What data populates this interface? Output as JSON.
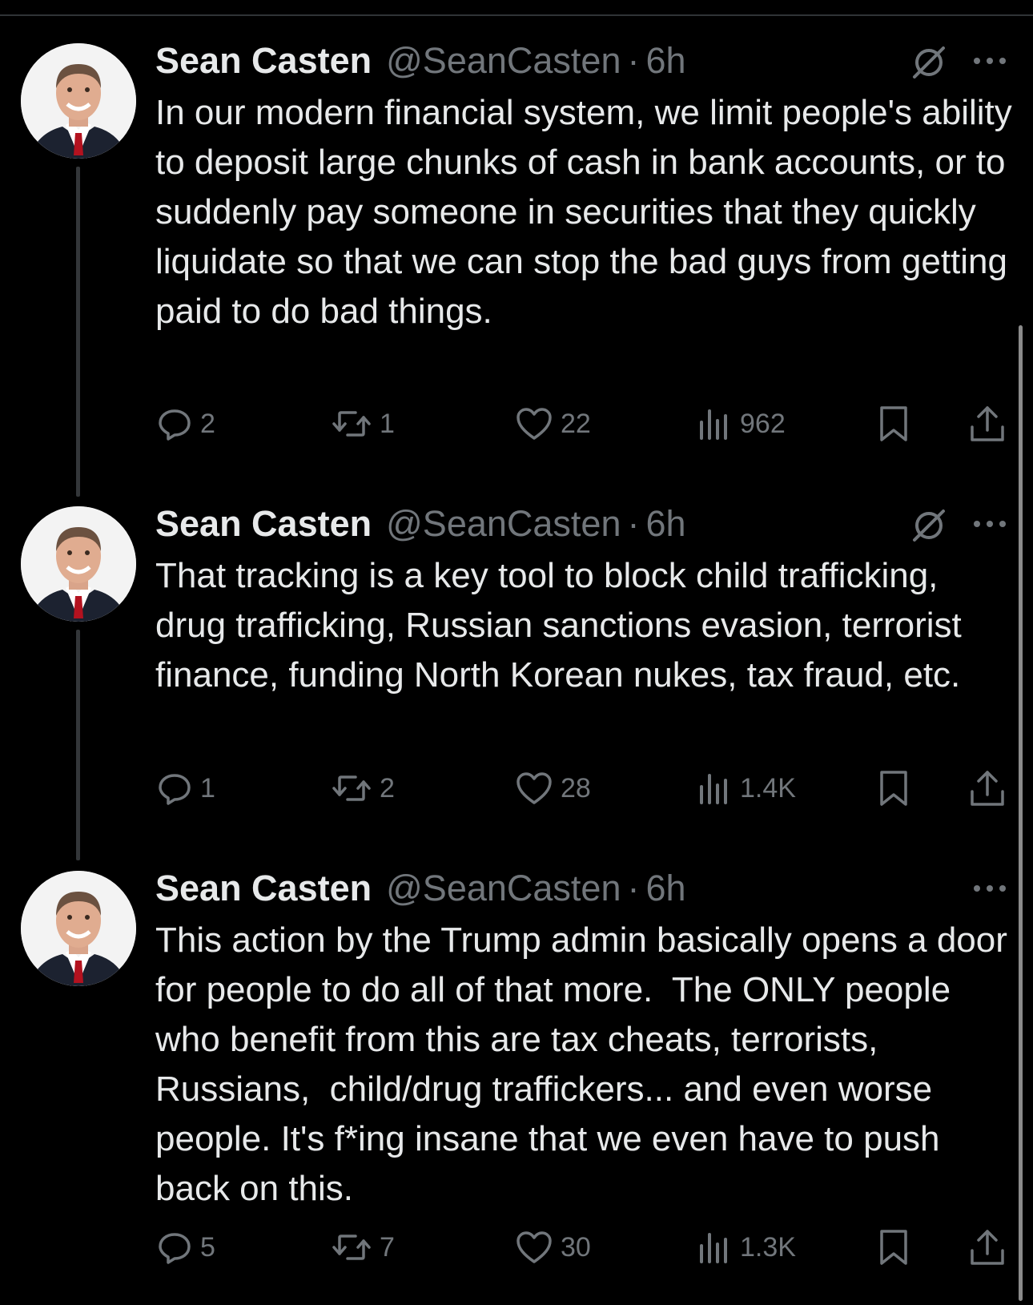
{
  "colors": {
    "background": "#000000",
    "text_primary": "#e7e9ea",
    "text_secondary": "#71767b",
    "thread_line": "#333639"
  },
  "icons": {
    "grok": "grok-icon",
    "more": "more-icon",
    "reply": "reply-icon",
    "repost": "repost-icon",
    "like": "heart-icon",
    "views": "views-icon",
    "bookmark": "bookmark-icon",
    "share": "share-icon"
  },
  "tweets": [
    {
      "author_name": "Sean Casten",
      "handle": "@SeanCasten",
      "separator": "·",
      "time": "6h",
      "text": "In our modern financial system, we limit people's ability to deposit large chunks of cash in bank accounts, or to suddenly pay someone in securities that they quickly liquidate so that we can stop the bad guys from getting paid to do bad things.",
      "replies": "2",
      "reposts": "1",
      "likes": "22",
      "views": "962"
    },
    {
      "author_name": "Sean Casten",
      "handle": "@SeanCasten",
      "separator": "·",
      "time": "6h",
      "text": "That tracking is a key tool to block child trafficking, drug trafficking, Russian sanctions evasion, terrorist finance, funding North Korean nukes, tax fraud, etc.",
      "replies": "1",
      "reposts": "2",
      "likes": "28",
      "views": "1.4K"
    },
    {
      "author_name": "Sean Casten",
      "handle": "@SeanCasten",
      "separator": "·",
      "time": "6h",
      "text": "This action by the Trump admin basically opens a door for people to do all of that more.  The ONLY people who benefit from this are tax cheats, terrorists, Russians,  child/drug traffickers... and even worse people. It's f*ing insane that we even have to push back on this.",
      "replies": "5",
      "reposts": "7",
      "likes": "30",
      "views": "1.3K"
    }
  ]
}
